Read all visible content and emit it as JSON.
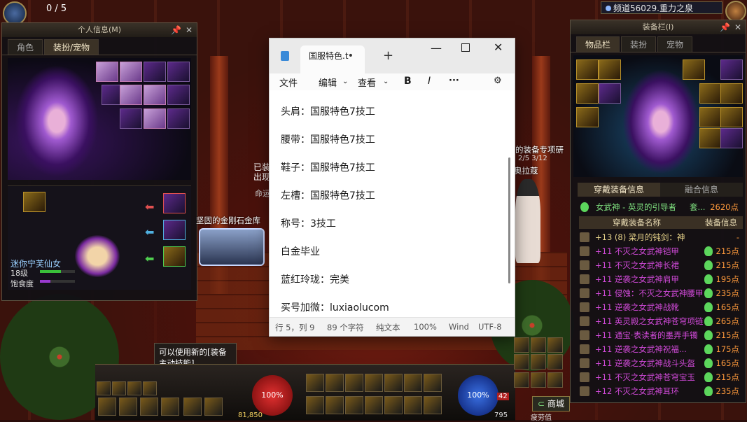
{
  "hud": {
    "counter": "0 / 5",
    "channel": "频道56029.重力之泉",
    "mp_value": "100%",
    "hp_value": "100%",
    "gold": "81,850",
    "shop": "商城",
    "skill_tip": "可以使用新的[装备主动技能]。",
    "fatigue_label": "疲劳值",
    "bottom_num": "795",
    "badge_42": "42",
    "shop_hint": "商城"
  },
  "personal_panel": {
    "title": "个人信息(M)",
    "tabs": [
      "角色",
      "装扮/宠物"
    ],
    "pet_name": "迷你宁芙仙女",
    "pet_level": "18级",
    "satiety": "饱食度"
  },
  "npc": {
    "chest_label": "坚固的金刚石金库",
    "quest_text": "的装备专项研",
    "quest_progress": "2/5  3/12",
    "npc_name": "奥拉蔻",
    "bubble_a": "已装",
    "bubble_b": "出现",
    "bubble_c": "命运"
  },
  "notepad": {
    "tab_title": "国服特色.t",
    "menu": [
      "文件",
      "编辑",
      "查看"
    ],
    "lines": [
      "头肩：国服特色7技工",
      "腰带：国服特色7技工",
      "鞋子：国服特色7技工",
      "左槽：国服特色7技工",
      "称号：3技工",
      "白金毕业",
      "蓝红玲珑：完美",
      "买号加微：luxiaolucom"
    ],
    "status": {
      "pos": "行 5，列 9",
      "chars": "89 个字符",
      "format": "纯文本",
      "zoom": "100%",
      "eol": "Wind",
      "encoding": "UTF-8"
    }
  },
  "equip_panel": {
    "title": "装备栏(I)",
    "tabs": [
      "物品栏",
      "装扮",
      "宠物"
    ],
    "info_tabs": [
      "穿戴装备信息",
      "融合信息"
    ],
    "set_name": "女武神 - 英灵的引导者",
    "set_suffix": "套...",
    "set_points": "2620点",
    "col_name": "穿戴装备名称",
    "col_info": "装备信息",
    "items": [
      {
        "name": "+13 (8) 梁月的钝剑：神",
        "pts": "-",
        "color": "#e6d28a"
      },
      {
        "name": "+11 不灭之女武神铠甲",
        "pts": "215点",
        "color": "#d14ad9"
      },
      {
        "name": "+11 不灭之女武神长裙",
        "pts": "215点",
        "color": "#d14ad9"
      },
      {
        "name": "+11 逆袭之女武神肩甲",
        "pts": "195点",
        "color": "#d14ad9"
      },
      {
        "name": "+11 侵蚀：不灭之女武神腰甲",
        "pts": "235点",
        "color": "#d14ad9"
      },
      {
        "name": "+11 逆袭之女武神战靴",
        "pts": "165点",
        "color": "#d14ad9"
      },
      {
        "name": "+11 英灵殿之女武神苍穹项链",
        "pts": "265点",
        "color": "#d14ad9"
      },
      {
        "name": "+11 通宝·表读者的墨弄手镯",
        "pts": "215点",
        "color": "#d14ad9"
      },
      {
        "name": "+11 逆袭之女武神祝福...",
        "pts": "175点",
        "color": "#d14ad9"
      },
      {
        "name": "+11 逆袭之女武神战斗头盔",
        "pts": "165点",
        "color": "#d14ad9"
      },
      {
        "name": "+11 不灭之女武神苍穹宝玉",
        "pts": "215点",
        "color": "#d14ad9"
      },
      {
        "name": "+12 不灭之女武神耳环",
        "pts": "235点",
        "color": "#d14ad9"
      }
    ]
  }
}
